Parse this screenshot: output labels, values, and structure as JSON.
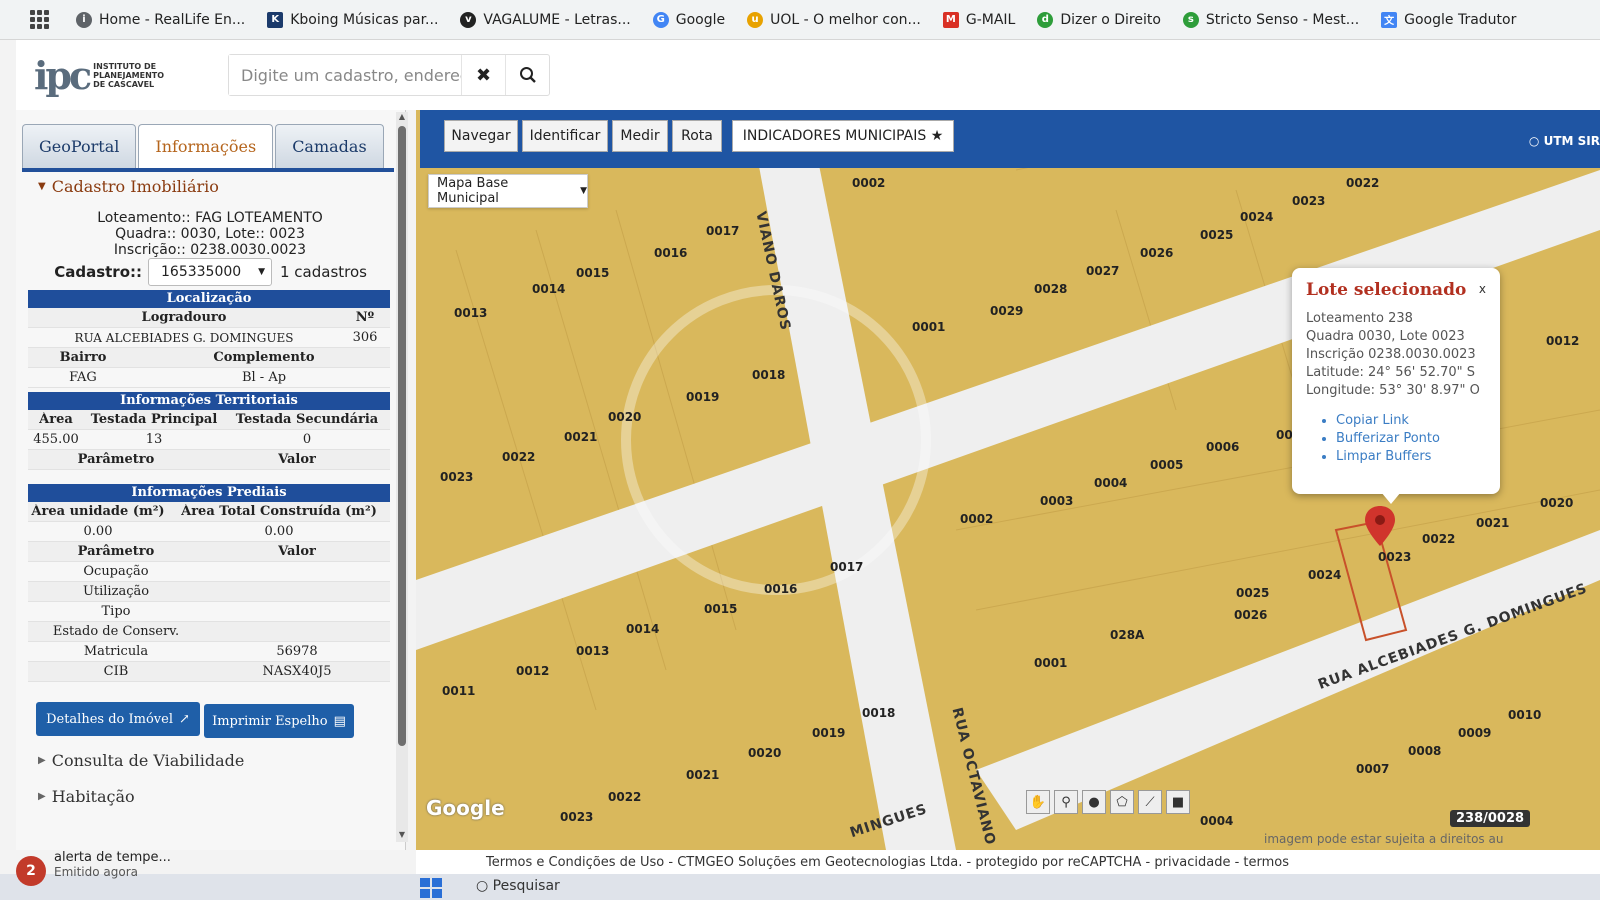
{
  "bookmarks": [
    {
      "label": "Home - RealLife En...",
      "icon": "info-icon",
      "color": "#5f6368"
    },
    {
      "label": "Kboing Músicas par...",
      "icon": "k-logo-icon",
      "color": "#1b3a6b"
    },
    {
      "label": "VAGALUME - Letras...",
      "icon": "vagalume-icon",
      "color": "#222222"
    },
    {
      "label": "Google",
      "icon": "google-icon",
      "color": "#4285f4"
    },
    {
      "label": "UOL - O melhor con...",
      "icon": "uol-icon",
      "color": "#e8a200"
    },
    {
      "label": "G-MAIL",
      "icon": "gmail-icon",
      "color": "#d93025"
    },
    {
      "label": "Dizer o Direito",
      "icon": "dizer-icon",
      "color": "#2e9d3a"
    },
    {
      "label": "Stricto Senso - Mest...",
      "icon": "stricto-icon",
      "color": "#2e9d3a"
    },
    {
      "label": "Google Tradutor",
      "icon": "translate-icon",
      "color": "#4285f4"
    }
  ],
  "header": {
    "logo_mark": "ipc",
    "logo_text": [
      "INSTITUTO DE",
      "PLANEJAMENTO",
      "DE CASCAVEL"
    ],
    "search_placeholder": "Digite um cadastro, endereç",
    "clear_icon": "✖",
    "search_icon": "search-icon"
  },
  "tabs": [
    {
      "label": "GeoPortal",
      "active": false
    },
    {
      "label": "Informações",
      "active": true
    },
    {
      "label": "Camadas",
      "active": false
    }
  ],
  "cadastro": {
    "section_title": "Cadastro Imobiliário",
    "loteamento": "Loteamento:: FAG LOTEAMENTO",
    "quadra_lote": "Quadra:: 0030, Lote:: 0023",
    "inscricao": "Inscrição:: 0238.0030.0023",
    "cadastro_label": "Cadastro::",
    "cadastro_value": "165335000",
    "cadastro_count": "1 cadastros"
  },
  "localizacao": {
    "title": "Localização",
    "logradouro_label": "Logradouro",
    "numero_label": "Nº",
    "logradouro": "RUA ALCEBIADES G. DOMINGUES",
    "numero": "306",
    "bairro_label": "Bairro",
    "complemento_label": "Complemento",
    "bairro": "FAG",
    "complemento": "Bl - Ap"
  },
  "territoriais": {
    "title": "Informações Territoriais",
    "area_label": "Área",
    "testada_principal_label": "Testada Principal",
    "testada_secundaria_label": "Testada Secundária",
    "area": "455.00",
    "testada_principal": "13",
    "testada_secundaria": "0",
    "parametro_label": "Parâmetro",
    "valor_label": "Valor"
  },
  "prediais": {
    "title": "Informações Prediais",
    "area_unidade_label": "Área unidade (m²)",
    "area_total_label": "Área Total Construída (m²)",
    "area_unidade": "0.00",
    "area_total": "0.00",
    "parametro_label": "Parâmetro",
    "valor_label": "Valor",
    "rows": [
      {
        "label": "Ocupação",
        "value": ""
      },
      {
        "label": "Utilização",
        "value": ""
      },
      {
        "label": "Tipo",
        "value": ""
      },
      {
        "label": "Estado de Conserv.",
        "value": ""
      },
      {
        "label": "Matricula",
        "value": "56978"
      },
      {
        "label": "CIB",
        "value": "NASX40J5"
      }
    ]
  },
  "buttons": {
    "detalhes": "Detalhes do Imóvel",
    "imprimir": "Imprimir Espelho"
  },
  "collapsed_sections": [
    "Consulta de Viabilidade",
    "Habitação"
  ],
  "map_toolbar": {
    "tools": [
      "Navegar",
      "Identificar",
      "Medir",
      "Rota"
    ],
    "indicadores": "INDICADORES MUNICIPAIS ★",
    "utm": "UTM SIR",
    "base_map": "Mapa Base Municipal"
  },
  "popup": {
    "title": "Lote selecionado",
    "close": "x",
    "lines": [
      "Loteamento 238",
      "Quadra 0030, Lote 0023",
      "Inscrição 0238.0030.0023",
      "Latitude: 24° 56' 52.70\" S",
      "Longitude: 53° 30' 8.97\" O"
    ],
    "links": [
      "Copiar Link",
      "Bufferizar Ponto",
      "Limpar Buffers"
    ]
  },
  "streets": {
    "daros": "VIANO DAROS",
    "octaviano": "RUA OCTAVIANO DA",
    "domingues": "RUA ALCEBIADES G. DOMINGUES",
    "mingues": "MINGUES"
  },
  "lots": [
    "0002",
    "0017",
    "0016",
    "0015",
    "0014",
    "0013",
    "0019",
    "0018",
    "0020",
    "0021",
    "0022",
    "0023",
    "0002",
    "0022",
    "0023",
    "0024",
    "0025",
    "0026",
    "0027",
    "0028",
    "0029",
    "0001",
    "0012",
    "0006",
    "0005",
    "0004",
    "0003",
    "0002",
    "0021",
    "0020",
    "0022",
    "0023",
    "0024",
    "0025",
    "0026",
    "0017",
    "0016",
    "0015",
    "0014",
    "0013",
    "0012",
    "0011",
    "0018",
    "0019",
    "0020",
    "0021",
    "0022",
    "0023",
    "028A",
    "0001",
    "0010",
    "0009",
    "0008",
    "0007",
    "0004",
    "00"
  ],
  "map_misc": {
    "google": "Google",
    "scale_badge": "238/0028",
    "image_note": "imagem pode estar sujeita a direitos au"
  },
  "footer": "Termos e Condições de Uso - CTMGEO Soluções em Geotecnologias Ltda. - protegido por reCAPTCHA - privacidade - termos",
  "notification": {
    "title": "alerta de tempe...",
    "sub": "Emitido agora"
  },
  "taskbar_search": "Pesquisar",
  "colors": {
    "primary": "#1f4e9b",
    "lot_fill": "#d9b85c",
    "popup_title": "#b23020",
    "marker": "#d0342c"
  }
}
